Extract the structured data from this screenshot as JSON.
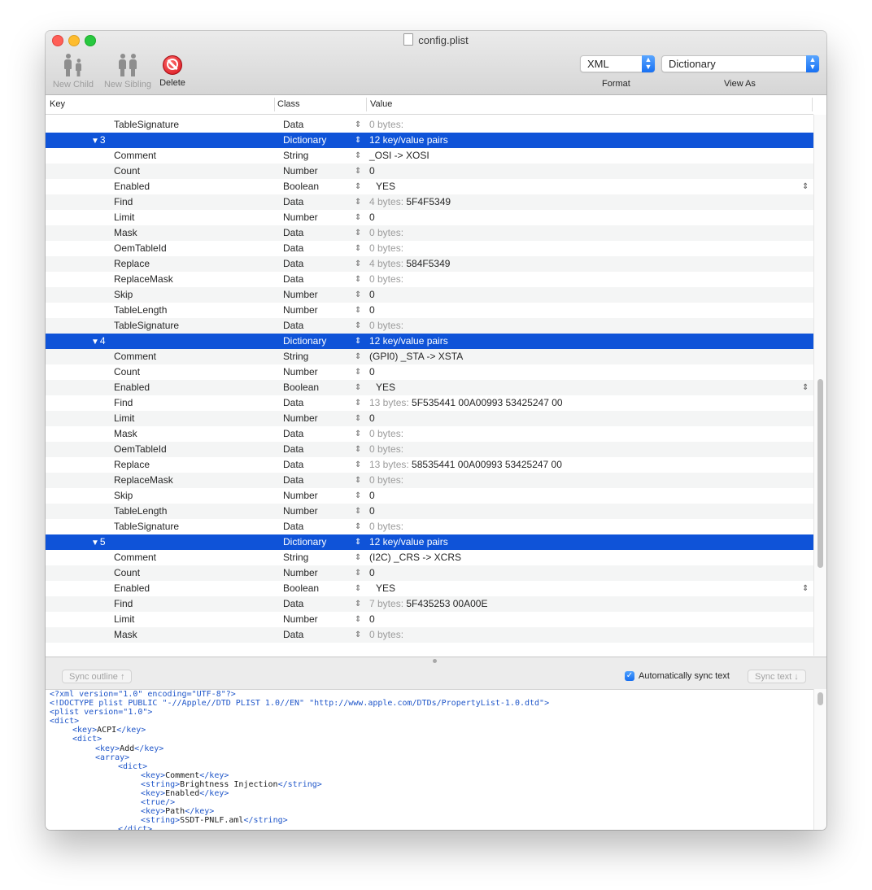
{
  "window": {
    "title": "config.plist"
  },
  "toolbar": {
    "new_child": "New Child",
    "new_sibling": "New Sibling",
    "delete": "Delete",
    "format_value": "XML",
    "format_caption": "Format",
    "view_as_value": "Dictionary",
    "view_as_caption": "View As"
  },
  "columns": {
    "key": "Key",
    "class": "Class",
    "value": "Value"
  },
  "rows": [
    {
      "key": "TableSignature",
      "class": "Data",
      "size": "0 bytes:",
      "value": ""
    },
    {
      "key": "3",
      "class": "Dictionary",
      "value": "12 key/value pairs",
      "parent": true
    },
    {
      "key": "Comment",
      "class": "String",
      "value": "_OSI -> XOSI"
    },
    {
      "key": "Count",
      "class": "Number",
      "value": "0"
    },
    {
      "key": "Enabled",
      "class": "Boolean",
      "value": "YES",
      "bool": true
    },
    {
      "key": "Find",
      "class": "Data",
      "size": "4 bytes:",
      "value": "5F4F5349"
    },
    {
      "key": "Limit",
      "class": "Number",
      "value": "0"
    },
    {
      "key": "Mask",
      "class": "Data",
      "size": "0 bytes:",
      "value": ""
    },
    {
      "key": "OemTableId",
      "class": "Data",
      "size": "0 bytes:",
      "value": ""
    },
    {
      "key": "Replace",
      "class": "Data",
      "size": "4 bytes:",
      "value": "584F5349"
    },
    {
      "key": "ReplaceMask",
      "class": "Data",
      "size": "0 bytes:",
      "value": ""
    },
    {
      "key": "Skip",
      "class": "Number",
      "value": "0"
    },
    {
      "key": "TableLength",
      "class": "Number",
      "value": "0"
    },
    {
      "key": "TableSignature",
      "class": "Data",
      "size": "0 bytes:",
      "value": ""
    },
    {
      "key": "4",
      "class": "Dictionary",
      "value": "12 key/value pairs",
      "parent": true
    },
    {
      "key": "Comment",
      "class": "String",
      "value": "(GPI0) _STA -> XSTA"
    },
    {
      "key": "Count",
      "class": "Number",
      "value": "0"
    },
    {
      "key": "Enabled",
      "class": "Boolean",
      "value": "YES",
      "bool": true
    },
    {
      "key": "Find",
      "class": "Data",
      "size": "13 bytes:",
      "value": "5F535441 00A00993 53425247 00"
    },
    {
      "key": "Limit",
      "class": "Number",
      "value": "0"
    },
    {
      "key": "Mask",
      "class": "Data",
      "size": "0 bytes:",
      "value": ""
    },
    {
      "key": "OemTableId",
      "class": "Data",
      "size": "0 bytes:",
      "value": ""
    },
    {
      "key": "Replace",
      "class": "Data",
      "size": "13 bytes:",
      "value": "58535441 00A00993 53425247 00"
    },
    {
      "key": "ReplaceMask",
      "class": "Data",
      "size": "0 bytes:",
      "value": ""
    },
    {
      "key": "Skip",
      "class": "Number",
      "value": "0"
    },
    {
      "key": "TableLength",
      "class": "Number",
      "value": "0"
    },
    {
      "key": "TableSignature",
      "class": "Data",
      "size": "0 bytes:",
      "value": ""
    },
    {
      "key": "5",
      "class": "Dictionary",
      "value": "12 key/value pairs",
      "parent": true
    },
    {
      "key": "Comment",
      "class": "String",
      "value": "(I2C) _CRS -> XCRS"
    },
    {
      "key": "Count",
      "class": "Number",
      "value": "0"
    },
    {
      "key": "Enabled",
      "class": "Boolean",
      "value": "YES",
      "bool": true
    },
    {
      "key": "Find",
      "class": "Data",
      "size": "7 bytes:",
      "value": "5F435253 00A00E"
    },
    {
      "key": "Limit",
      "class": "Number",
      "value": "0"
    },
    {
      "key": "Mask",
      "class": "Data",
      "size": "0 bytes:",
      "value": ""
    }
  ],
  "sync": {
    "sync_outline": "Sync outline ↑",
    "auto_sync_label": "Automatically sync text",
    "auto_sync_checked": true,
    "sync_text": "Sync text ↓"
  },
  "xml_lines": [
    {
      "indent": 0,
      "parts": [
        [
          "decl",
          "<?xml version=\"1.0\" encoding=\"UTF-8\"?>"
        ]
      ]
    },
    {
      "indent": 0,
      "parts": [
        [
          "decl",
          "<!DOCTYPE plist PUBLIC \"-//Apple//DTD PLIST 1.0//EN\" \"http://www.apple.com/DTDs/PropertyList-1.0.dtd\">"
        ]
      ]
    },
    {
      "indent": 0,
      "parts": [
        [
          "tag",
          "<plist version=\"1.0\">"
        ]
      ]
    },
    {
      "indent": 0,
      "parts": [
        [
          "tag",
          "<dict>"
        ]
      ]
    },
    {
      "indent": 1,
      "parts": [
        [
          "tag",
          "<key>"
        ],
        [
          "txt",
          "ACPI"
        ],
        [
          "tag",
          "</key>"
        ]
      ]
    },
    {
      "indent": 1,
      "parts": [
        [
          "tag",
          "<dict>"
        ]
      ]
    },
    {
      "indent": 2,
      "parts": [
        [
          "tag",
          "<key>"
        ],
        [
          "txt",
          "Add"
        ],
        [
          "tag",
          "</key>"
        ]
      ]
    },
    {
      "indent": 2,
      "parts": [
        [
          "tag",
          "<array>"
        ]
      ]
    },
    {
      "indent": 3,
      "parts": [
        [
          "tag",
          "<dict>"
        ]
      ]
    },
    {
      "indent": 4,
      "parts": [
        [
          "tag",
          "<key>"
        ],
        [
          "txt",
          "Comment"
        ],
        [
          "tag",
          "</key>"
        ]
      ]
    },
    {
      "indent": 4,
      "parts": [
        [
          "tag",
          "<string>"
        ],
        [
          "txt",
          "Brightness Injection"
        ],
        [
          "tag",
          "</string>"
        ]
      ]
    },
    {
      "indent": 4,
      "parts": [
        [
          "tag",
          "<key>"
        ],
        [
          "txt",
          "Enabled"
        ],
        [
          "tag",
          "</key>"
        ]
      ]
    },
    {
      "indent": 4,
      "parts": [
        [
          "tag",
          "<true/>"
        ]
      ]
    },
    {
      "indent": 4,
      "parts": [
        [
          "tag",
          "<key>"
        ],
        [
          "txt",
          "Path"
        ],
        [
          "tag",
          "</key>"
        ]
      ]
    },
    {
      "indent": 4,
      "parts": [
        [
          "tag",
          "<string>"
        ],
        [
          "txt",
          "SSDT-PNLF.aml"
        ],
        [
          "tag",
          "</string>"
        ]
      ]
    },
    {
      "indent": 3,
      "parts": [
        [
          "tag",
          "</dict>"
        ]
      ]
    }
  ]
}
